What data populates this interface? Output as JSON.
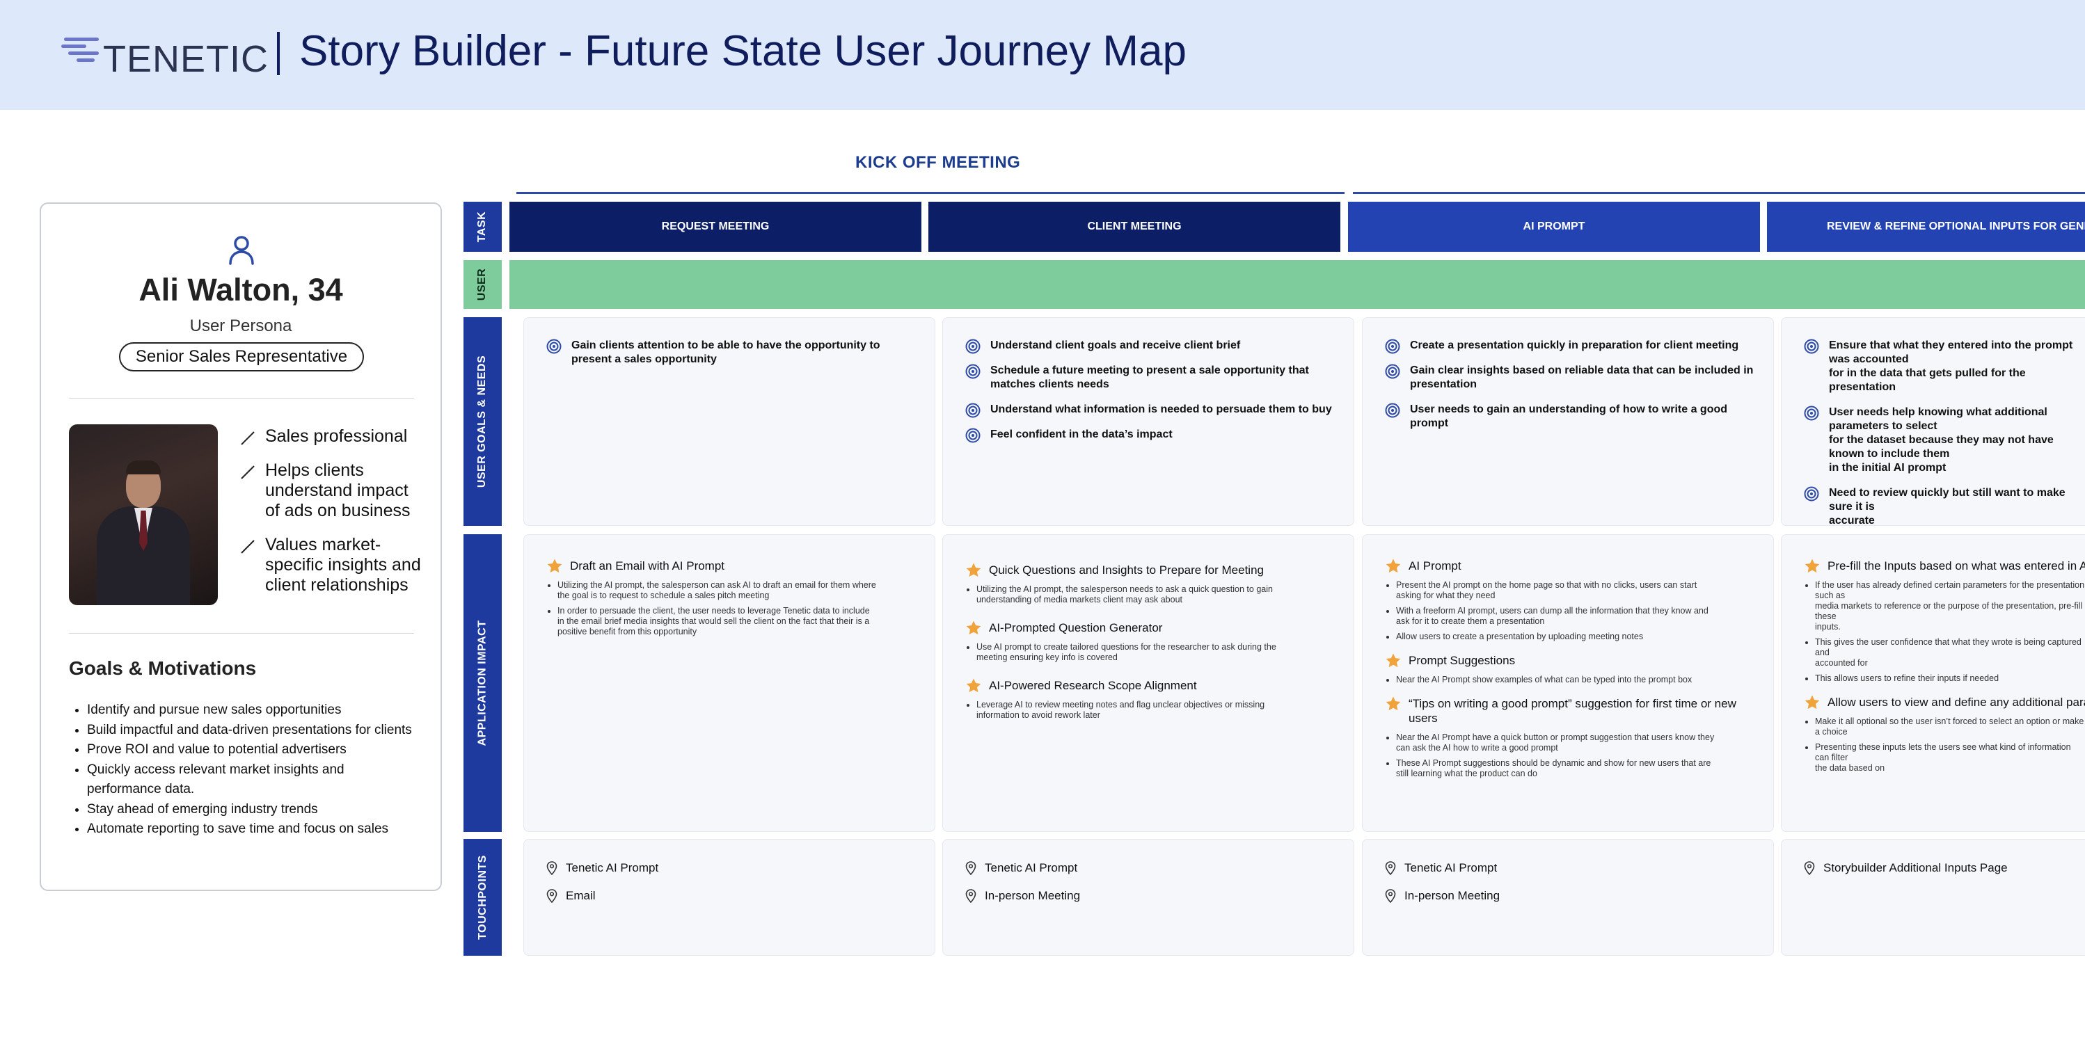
{
  "header": {
    "logo_text": "TENETIC",
    "title": "Story Builder  - Future State User Journey Map"
  },
  "persona": {
    "name": "Ali Walton, 34",
    "role": "User Persona",
    "job_title": "Senior Sales Representative",
    "traits": [
      "Sales professional",
      "Helps clients understand impact of ads on business",
      "Values market-specific insights and client relationships"
    ],
    "goals_title": "Goals & Motivations",
    "goals": [
      "Identify and pursue new sales opportunities",
      "Build impactful and data-driven presentations for clients",
      "Prove ROI and value to potential advertisers",
      "Quickly access relevant market insights and performance data.",
      "Stay ahead of emerging industry trends",
      "Automate reporting to save time and focus on sales"
    ]
  },
  "journey": {
    "phase": "KICK OFF MEETING",
    "row_labels": {
      "task": "TASK",
      "user": "USER",
      "goals": "USER GOALS & NEEDS",
      "impact": "APPLICATION IMPACT",
      "touchpoints": "TOUCHPOINTS"
    },
    "columns": [
      {
        "task": "REQUEST MEETING",
        "needs": [
          "Gain clients attention to be able to have the opportunity to\npresent a sales opportunity"
        ],
        "features": [
          {
            "title": "Draft an Email with AI Prompt",
            "bullets": [
              "Utilizing the AI prompt, the salesperson can ask AI to draft an email for them where\nthe goal is to request to schedule a sales pitch meeting",
              "In order to persuade the client, the user needs to leverage Tenetic data to include\nin the email brief media insights that would sell the client on the fact that their is a\npositive benefit from this opportunity"
            ]
          }
        ],
        "touchpoints": [
          "Tenetic AI Prompt",
          "Email"
        ]
      },
      {
        "task": "CLIENT MEETING",
        "needs": [
          "Understand client goals and receive client brief",
          "Schedule a future meeting to present a sale opportunity that\nmatches clients needs",
          "Understand what information is needed to persuade them to buy",
          "Feel confident in the data’s impact"
        ],
        "features": [
          {
            "title": "Quick Questions and Insights to Prepare for Meeting",
            "bullets": [
              "Utilizing the AI prompt, the salesperson needs to ask a quick question to gain\nunderstanding of media markets client may ask about"
            ]
          },
          {
            "title": "AI-Prompted Question Generator",
            "bullets": [
              "Use AI prompt to create tailored questions for the researcher to ask during the\nmeeting ensuring key info is covered"
            ]
          },
          {
            "title": "AI-Powered Research Scope Alignment",
            "bullets": [
              "Leverage AI to review meeting notes and flag unclear objectives or missing\ninformation to avoid rework later"
            ]
          }
        ],
        "touchpoints": [
          "Tenetic AI Prompt",
          "In-person Meeting"
        ]
      },
      {
        "task": "AI PROMPT",
        "needs": [
          "Create a presentation quickly in preparation for client meeting",
          "Gain clear insights based on reliable data that can be included in\npresentation",
          "User needs to gain an understanding of how to write a good\nprompt"
        ],
        "features": [
          {
            "title": "AI Prompt",
            "bullets": [
              "Present the AI prompt on the home page so that with no clicks, users can start\nasking for what they need",
              "With a freeform AI prompt, users can dump all the information that they know and\nask for it to create them a presentation",
              "Allow users to create a presentation by uploading meeting notes"
            ]
          },
          {
            "title": "Prompt Suggestions",
            "bullets": [
              "Near the AI Prompt show examples of what can be typed into the prompt box"
            ]
          },
          {
            "title": "“Tips on writing a good prompt” suggestion for first time or new\nusers",
            "bullets": [
              "Near the AI Prompt have a quick button or prompt suggestion that users know they\ncan ask the AI how to write a good prompt",
              "These AI Prompt suggestions should be dynamic and show for new users that are\nstill learning what the product can do"
            ]
          }
        ],
        "touchpoints": [
          "Tenetic AI Prompt",
          "In-person Meeting"
        ]
      },
      {
        "task": "REVIEW & REFINE OPTIONAL INPUTS FOR GENERATION",
        "needs": [
          "Ensure that what they entered into the prompt was accounted\nfor in the data that gets pulled for the presentation",
          "User needs help knowing what additional parameters to select\nfor the dataset because they may not have known to include them\nin the initial AI prompt",
          "Need to review quickly but still want to make sure it is\naccurate"
        ],
        "features": [
          {
            "title": "Pre-fill the Inputs based on what was entered in AI Prompt",
            "bullets": [
              "If the user has already defined certain parameters for the presentation such as\nmedia markets to reference or the purpose of the presentation, pre-fill these\ninputs.",
              "This gives the user confidence that what they wrote is being captured and\naccounted for",
              "This allows users to refine their inputs if needed"
            ]
          },
          {
            "title": "Allow users to view and define any additional parameters",
            "bullets": [
              "Make it all optional so the user isn’t forced to select an option or make a choice",
              "Presenting these inputs lets the users see what kind of information can filter\nthe data based on"
            ]
          }
        ],
        "touchpoints": [
          "Storybuilder Additional Inputs Page"
        ]
      }
    ]
  },
  "colors": {
    "header_bg": "#dde8fb",
    "brand_navy": "#0f1d5c",
    "task_dark": "#0c1f66",
    "task_blue": "#2443b3",
    "row_label_blue": "#1e3a9e",
    "user_green": "#7ecb9c",
    "star_orange": "#f0a33a",
    "target_blue": "#2c4aa6"
  },
  "icons": [
    "person-icon",
    "slash-icon",
    "target-icon",
    "star-icon",
    "location-pin-icon"
  ]
}
